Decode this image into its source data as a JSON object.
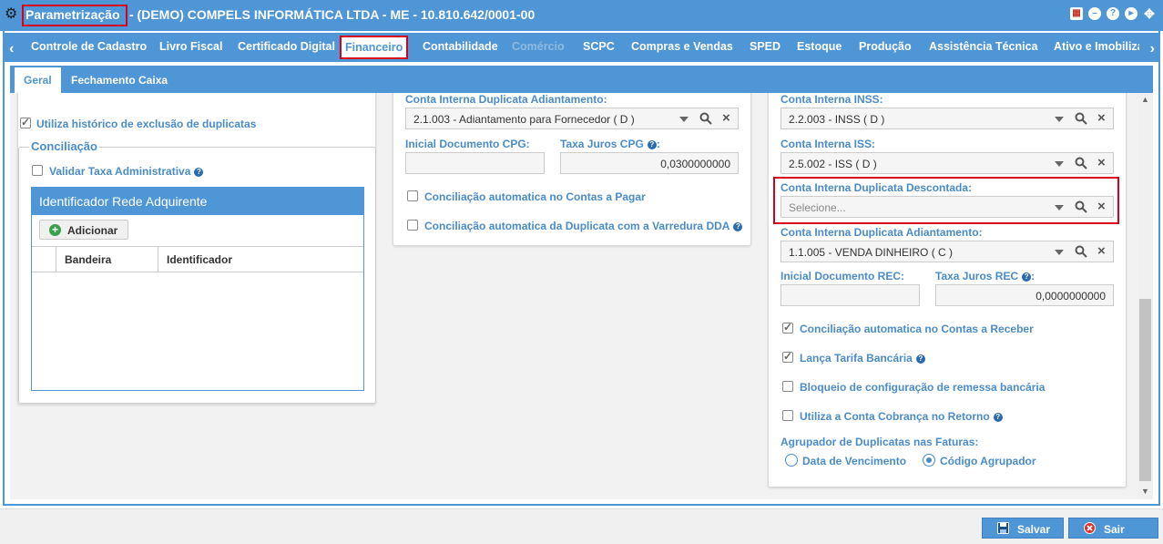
{
  "window": {
    "title": "Parametrização",
    "subtitle": "- (DEMO) COMPELS INFORMÁTICA LTDA - ME - 10.810.642/0001-00",
    "icons": [
      "calendar-icon",
      "minimize-icon",
      "help-icon",
      "play-icon",
      "fullscreen-icon"
    ]
  },
  "module_tabs": [
    {
      "label": "Controle de Cadastro"
    },
    {
      "label": "Livro Fiscal"
    },
    {
      "label": "Certificado Digital"
    },
    {
      "label": "Financeiro",
      "active": true
    },
    {
      "label": "Contabilidade"
    },
    {
      "label": "Comércio",
      "disabled": true
    },
    {
      "label": "SCPC"
    },
    {
      "label": "Compras e Vendas"
    },
    {
      "label": "SPED"
    },
    {
      "label": "Estoque"
    },
    {
      "label": "Produção"
    },
    {
      "label": "Assistência Técnica"
    },
    {
      "label": "Ativo e Imobilizado"
    }
  ],
  "sub_tabs": [
    {
      "label": "Geral",
      "active": true
    },
    {
      "label": "Fechamento Caixa"
    }
  ],
  "left": {
    "historico_label": "Utiliza histórico de exclusão de duplicatas",
    "historico_checked": true,
    "conciliacao_legend": "Conciliação",
    "validar_taxa_label": "Validar Taxa Administrativa",
    "validar_taxa_checked": false,
    "grid_title": "Identificador Rede Adquirente",
    "add_button": "Adicionar",
    "columns": [
      "Bandeira",
      "Identificador"
    ]
  },
  "middle": {
    "conta_adiant_label": "Conta Interna Duplicata Adiantamento:",
    "conta_adiant_value": "2.1.003 - Adiantamento para Fornecedor ( D )",
    "inicial_doc_label": "Inicial Documento CPG:",
    "inicial_doc_value": "",
    "taxa_juros_label": "Taxa Juros CPG",
    "taxa_juros_value": "0,0300000000",
    "conc_pagar_label": "Conciliação automatica no Contas a Pagar",
    "conc_pagar_checked": false,
    "conc_dda_label": "Conciliação automatica da Duplicata com a Varredura DDA",
    "conc_dda_checked": false
  },
  "right": {
    "inss_label": "Conta Interna INSS:",
    "inss_value": "2.2.003 - INSS ( D )",
    "iss_label": "Conta Interna ISS:",
    "iss_value": "2.5.002 - ISS ( D )",
    "descontada_label": "Conta Interna Duplicata Descontada:",
    "descontada_placeholder": "Selecione...",
    "adiant_label": "Conta Interna Duplicata Adiantamento:",
    "adiant_value": "1.1.005 - VENDA DINHEIRO ( C )",
    "inicial_doc_label": "Inicial Documento REC:",
    "inicial_doc_value": "",
    "taxa_juros_label": "Taxa Juros REC",
    "taxa_juros_value": "0,0000000000",
    "conc_receber_label": "Conciliação automatica no Contas a Receber",
    "conc_receber_checked": true,
    "tarifa_label": "Lança Tarifa Bancária",
    "tarifa_checked": true,
    "bloqueio_label": "Bloqueio de configuração de remessa bancária",
    "bloqueio_checked": false,
    "cobranca_label": "Utiliza a Conta Cobrança no Retorno",
    "cobranca_checked": false,
    "agrupador_label": "Agrupador de Duplicatas nas Faturas:",
    "radio_options": [
      "Data de Vencimento",
      "Código Agrupador"
    ],
    "radio_selected": "Código Agrupador"
  },
  "footer": {
    "save_label": "Salvar",
    "exit_label": "Sair"
  },
  "colors": {
    "primary": "#4e96d6",
    "label": "#4a8cc9",
    "highlight": "#d6001c"
  }
}
